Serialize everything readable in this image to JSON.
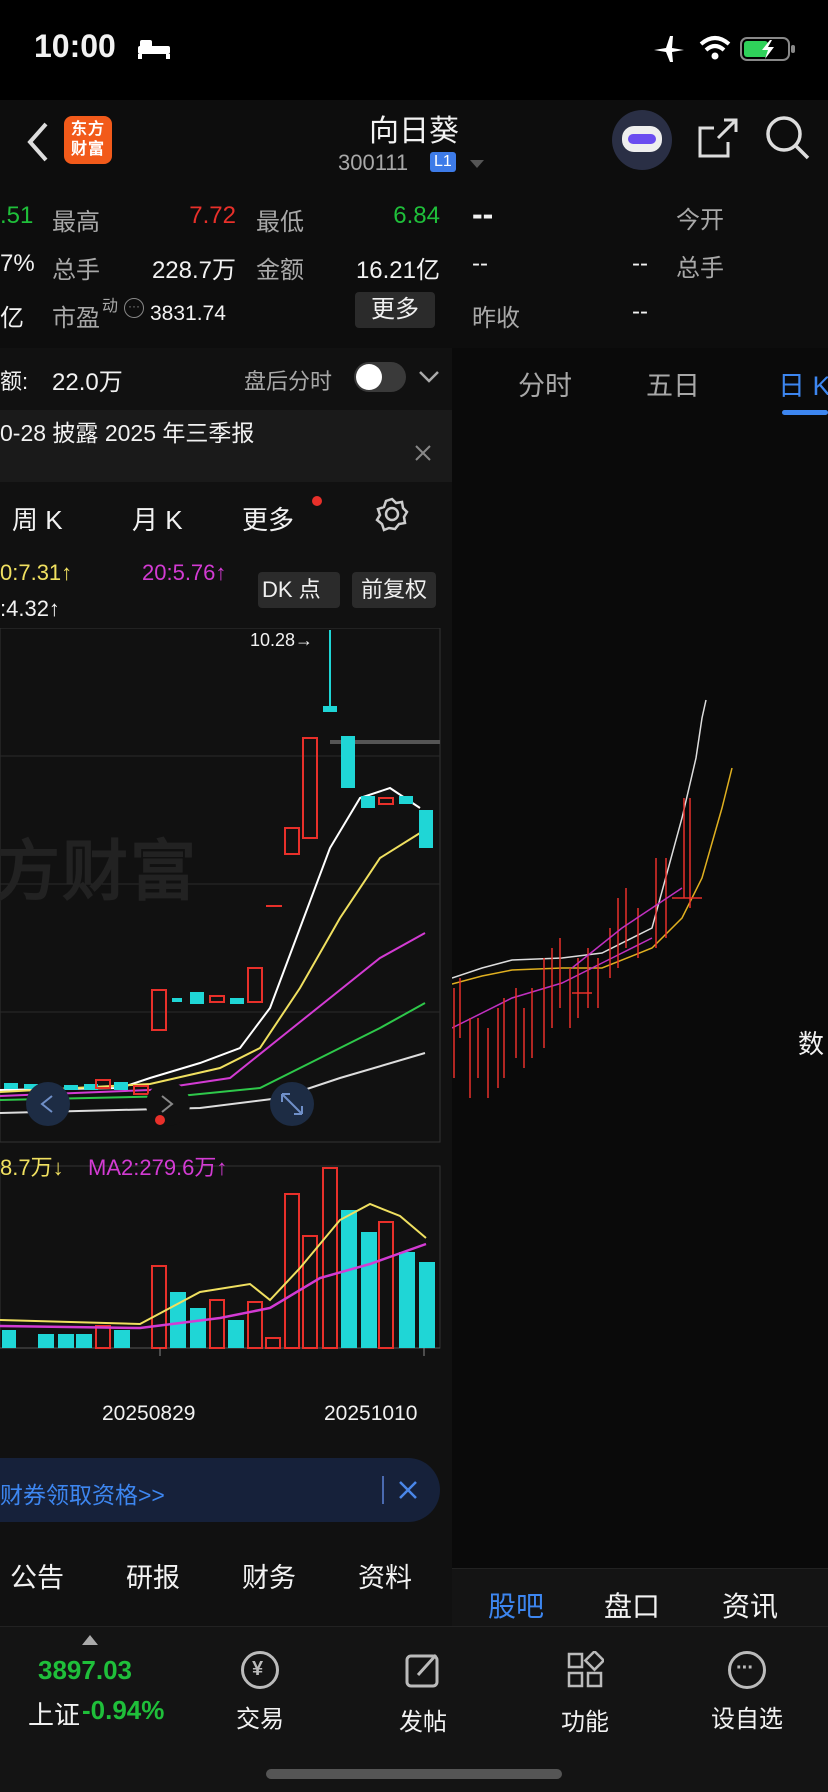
{
  "status": {
    "time": "10:00"
  },
  "header": {
    "brand_logo": "东方财富",
    "stock_name": "向日葵",
    "stock_code": "300111",
    "level_badge": "L1"
  },
  "quote": {
    "left_partial_1": ".51",
    "high_label": "最高",
    "high_value": "7.72",
    "low_label": "最低",
    "low_value": "6.84",
    "left_partial_2": "7%",
    "volume_label": "总手",
    "volume_value": "228.7万",
    "amount_label": "金额",
    "amount_value": "16.21亿",
    "left_partial_3": "亿",
    "pe_label": "市盈",
    "pe_sup": "动",
    "pe_value": "3831.74",
    "more_button": "更多",
    "right_dash_big": "--",
    "right_open_label": "今开",
    "right_dash_1": "--",
    "right_dash_2": "--",
    "right_volume_label": "总手",
    "right_prevclose_label": "昨收",
    "right_dash_3": "--"
  },
  "after_hours": {
    "label": "额:",
    "value": "22.0万",
    "toggle_label": "盘后分时"
  },
  "notice": {
    "text": "0-28 披露 2025 年三季报"
  },
  "chart_tabs_left": {
    "week": "周 K",
    "month": "月 K",
    "more": "更多"
  },
  "chart_tabs_right": {
    "intraday": "分时",
    "five_day": "五日",
    "daily": "日 K"
  },
  "ma_labels": {
    "ma10_partial": "0:7.31↑",
    "ma20": "20:5.76↑",
    "ma_partial_2": ":4.32↑",
    "dk_button": "DK 点",
    "adjust_button": "前复权"
  },
  "chart_annotation": {
    "high_marker": "10.28→",
    "watermark": "方财富"
  },
  "volume_labels": {
    "ma1_partial": "8.7万↓",
    "ma2": "MA2:279.6万↑"
  },
  "x_axis": {
    "date1": "20250829",
    "date2": "20251010"
  },
  "promo": {
    "text": "财券领取资格>>"
  },
  "bottom_tabs_left": [
    "公告",
    "研报",
    "财务",
    "资料"
  ],
  "bottom_tabs_right": [
    "股吧",
    "盘口",
    "资讯"
  ],
  "right_side_partial": "数",
  "tabbar": {
    "index_value": "3897.03",
    "index_name": "上证",
    "index_change": "-0.94%",
    "trade": "交易",
    "post": "发帖",
    "functions": "功能",
    "watchlist": "设自选"
  },
  "colors": {
    "up": "#e8302a",
    "down": "#1fd6d6",
    "accent": "#3d86f0"
  }
}
